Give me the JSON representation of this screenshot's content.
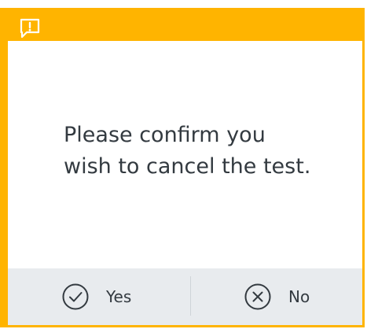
{
  "dialog": {
    "header_icon": "message-alert-icon",
    "message_line1": "Please confirm you",
    "message_line2": "wish to cancel the test.",
    "buttons": {
      "yes": {
        "label": "Yes",
        "icon": "check-circle-icon"
      },
      "no": {
        "label": "No",
        "icon": "x-circle-icon"
      }
    }
  },
  "colors": {
    "accent": "#ffb400",
    "text": "#333a40",
    "footer_bg": "#e8ebee"
  }
}
